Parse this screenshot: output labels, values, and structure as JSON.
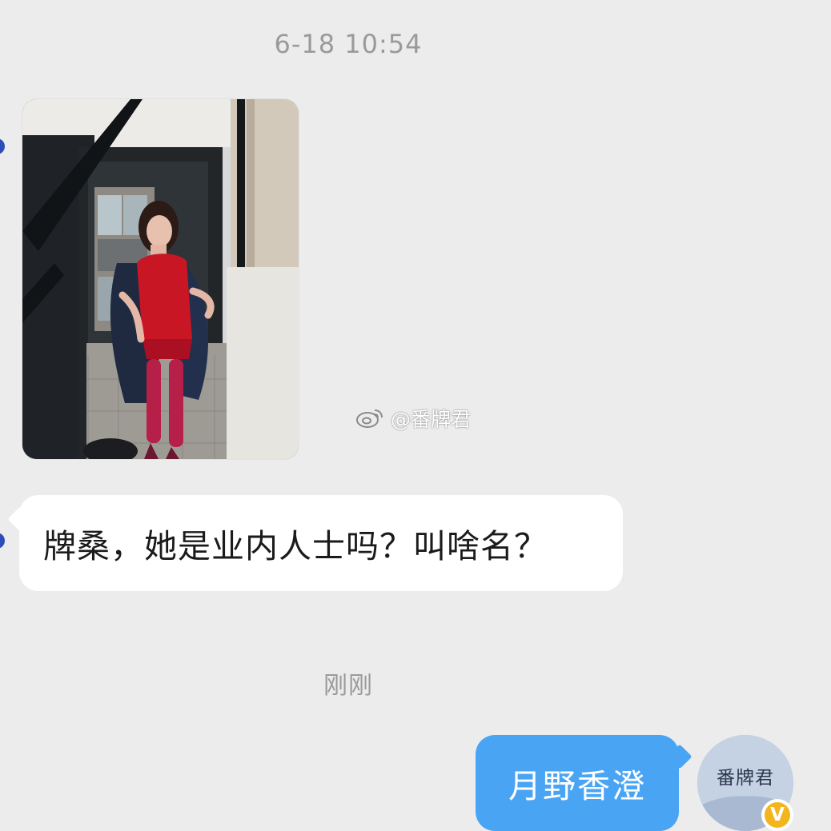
{
  "conversation": {
    "timestamps": {
      "first": "6-18 10:54",
      "second": "刚刚"
    },
    "incoming_image": {
      "alt": "photo-message",
      "watermark_text": "@番牌君",
      "watermark_icon": "weibo-icon"
    },
    "incoming_message": "牌桑，她是业内人士吗？叫啥名？",
    "outgoing_message": "月野香澄",
    "self_avatar": {
      "text": "番牌君",
      "verified_badge": "V"
    }
  },
  "colors": {
    "background": "#ececec",
    "incoming_bubble": "#ffffff",
    "outgoing_bubble": "#4aa4f4",
    "timestamp_text": "#9a9a9a",
    "verified_badge": "#f3b51d"
  }
}
